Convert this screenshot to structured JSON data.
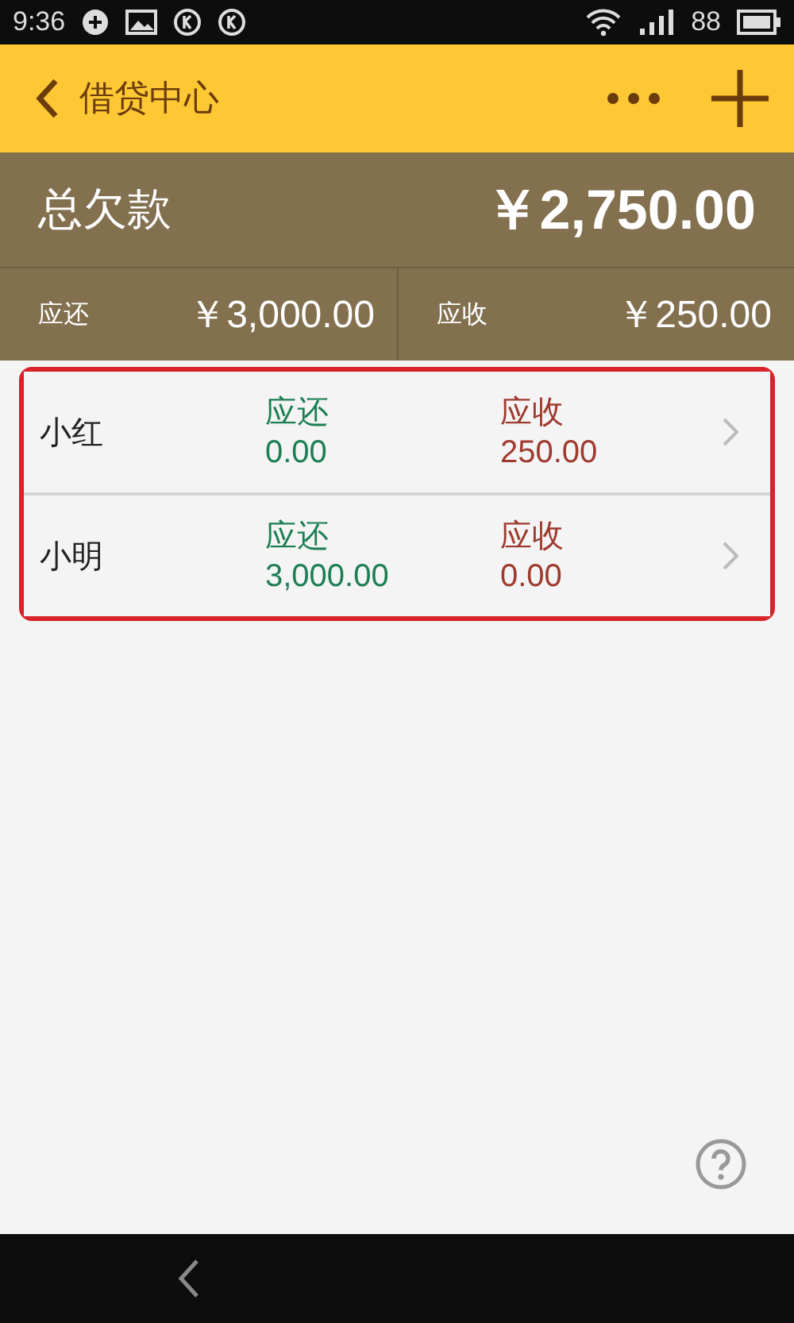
{
  "status_bar": {
    "time": "9:36",
    "battery": "88"
  },
  "app_bar": {
    "title": "借贷中心"
  },
  "summary": {
    "label": "总欠款",
    "amount": "￥2,750.00",
    "items": [
      {
        "label": "应还",
        "amount": "￥3,000.00"
      },
      {
        "label": "应收",
        "amount": "￥250.00"
      }
    ]
  },
  "people": [
    {
      "name": "小红",
      "payable_label": "应还",
      "payable": "0.00",
      "receivable_label": "应收",
      "receivable": "250.00"
    },
    {
      "name": "小明",
      "payable_label": "应还",
      "payable": "3,000.00",
      "receivable_label": "应收",
      "receivable": "0.00"
    }
  ],
  "highlight": {
    "color": "#d8232a"
  }
}
